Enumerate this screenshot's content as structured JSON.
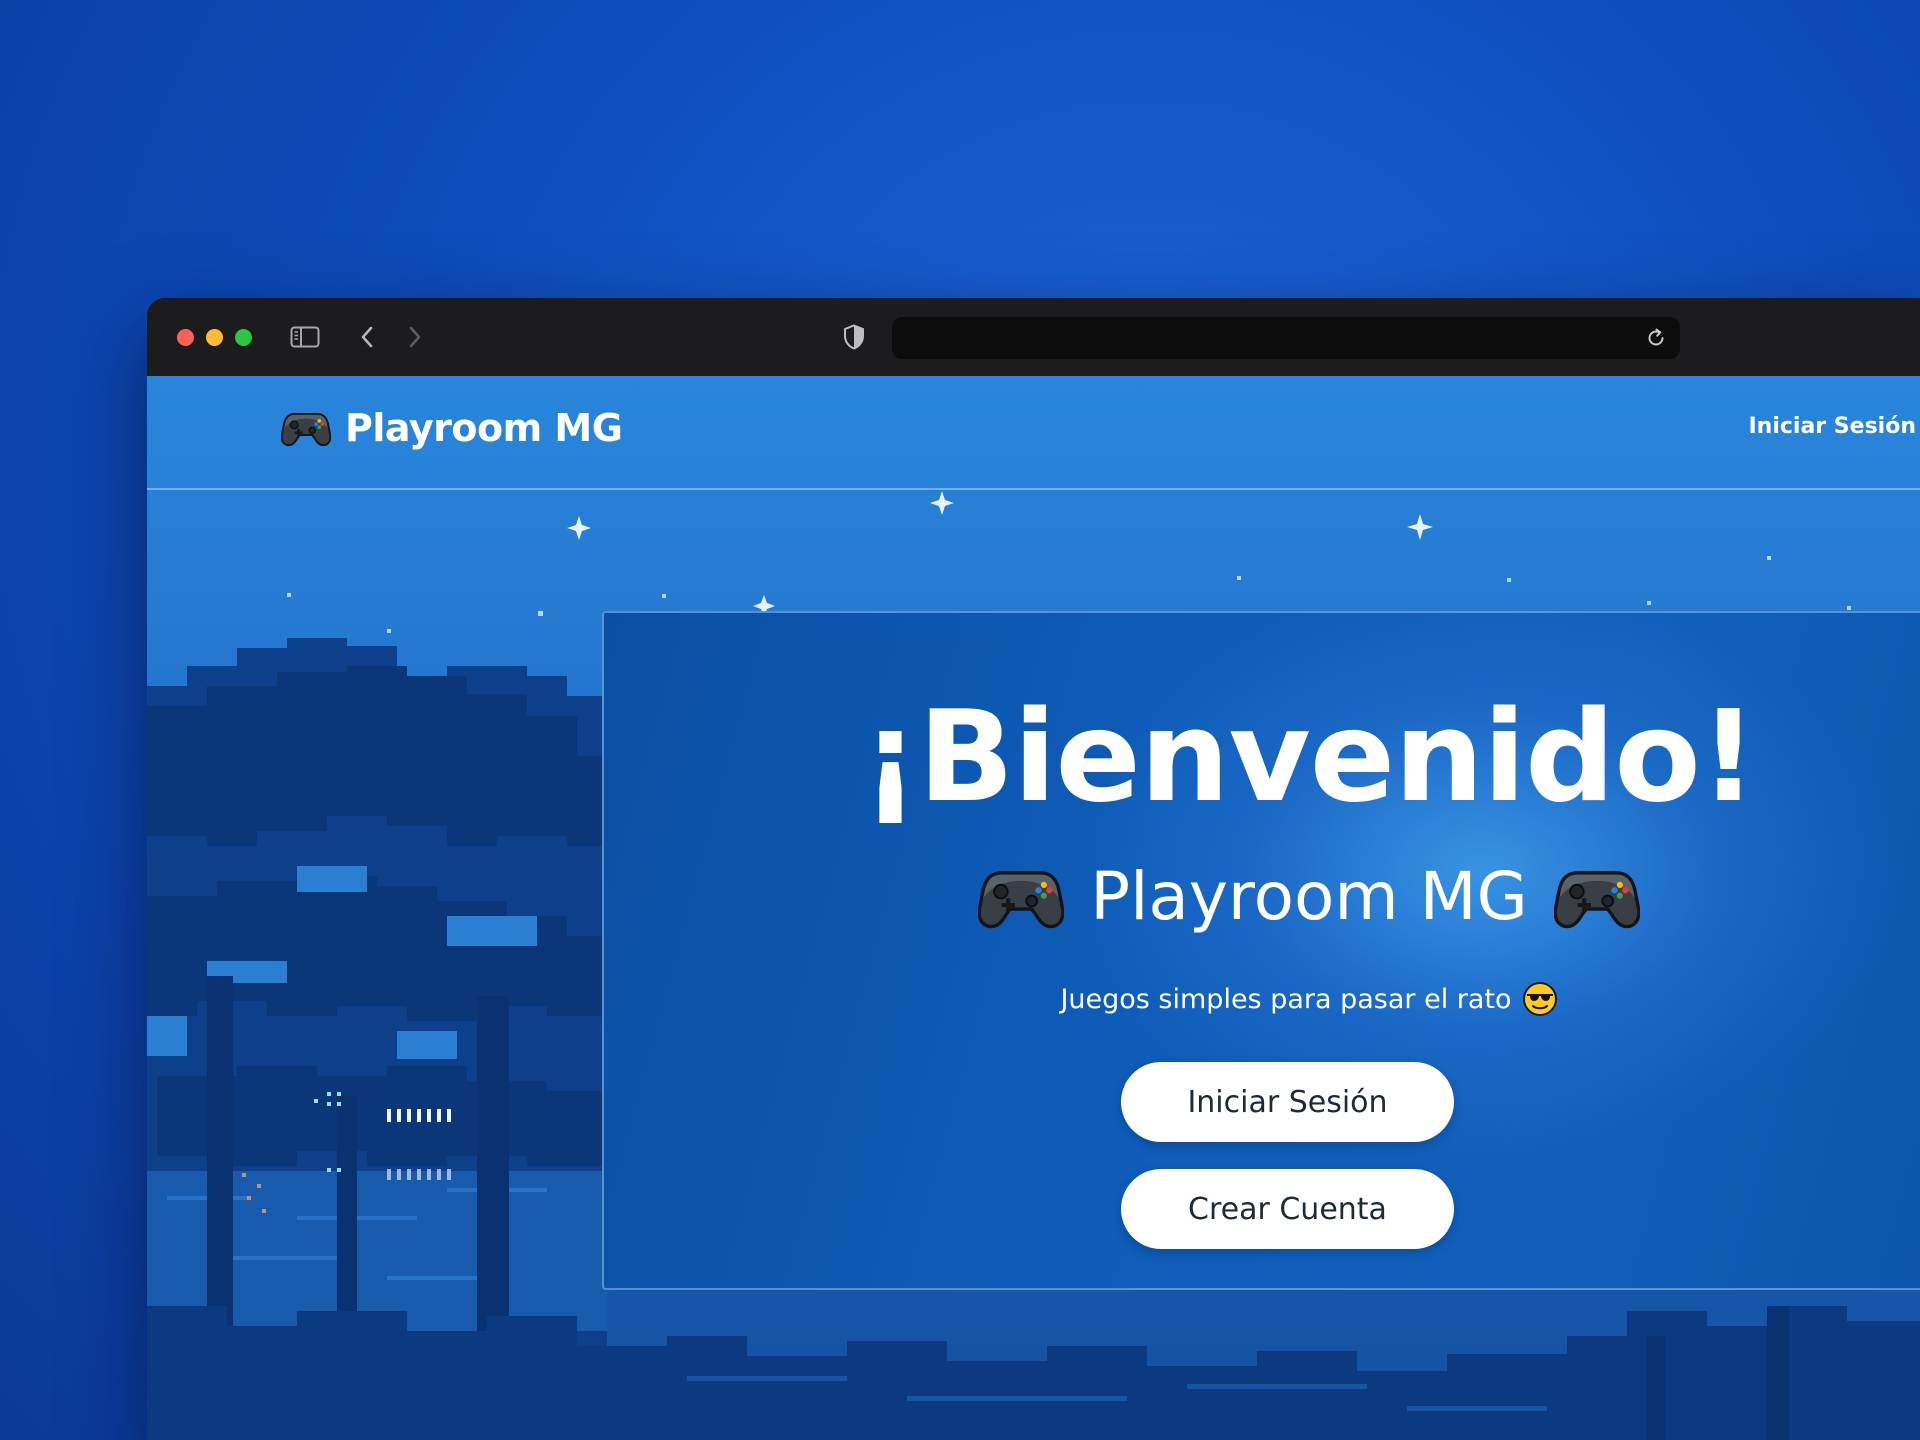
{
  "browser": {
    "icons": {
      "sidebar_toggle": "sidebar-icon",
      "back": "chevron-left-icon",
      "forward": "chevron-right-icon",
      "privacy": "shield-icon",
      "reload": "reload-icon"
    }
  },
  "navbar": {
    "brand_icon": "gamepad-icon",
    "brand_title": "Playroom MG",
    "login_link": "Iniciar Sesión"
  },
  "hero": {
    "title": "¡Bienvenido!",
    "brand": "Playroom MG",
    "brand_icon": "gamepad-icon",
    "tagline": "Juegos simples para pasar el rato",
    "tagline_icon": "sunglasses-smiley-icon",
    "login_button": "Iniciar Sesión",
    "register_button": "Crear Cuenta"
  },
  "colors": {
    "desktop_background": "#0d4cba",
    "titlebar": "#1c1c1e",
    "page_sky": "#2a84da",
    "card": "#0e5cb8",
    "button": "#ffffff",
    "button_text": "#1f2a37"
  }
}
